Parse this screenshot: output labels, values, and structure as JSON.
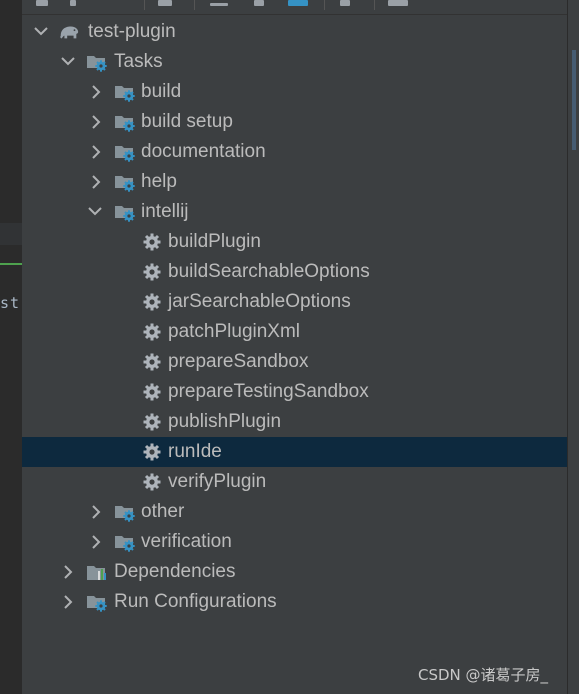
{
  "tree": {
    "root": {
      "label": "test-plugin",
      "icon": "gradle-elephant-icon"
    },
    "tasks": {
      "label": "Tasks"
    },
    "groups_top": [
      {
        "label": "build"
      },
      {
        "label": "build setup"
      },
      {
        "label": "documentation"
      },
      {
        "label": "help"
      }
    ],
    "intellij": {
      "label": "intellij",
      "tasks": [
        {
          "label": "buildPlugin"
        },
        {
          "label": "buildSearchableOptions"
        },
        {
          "label": "jarSearchableOptions"
        },
        {
          "label": "patchPluginXml"
        },
        {
          "label": "prepareSandbox"
        },
        {
          "label": "prepareTestingSandbox"
        },
        {
          "label": "publishPlugin"
        },
        {
          "label": "runIde",
          "selected": true
        },
        {
          "label": "verifyPlugin"
        }
      ]
    },
    "groups_bottom": [
      {
        "label": "other"
      },
      {
        "label": "verification"
      }
    ],
    "dependencies": {
      "label": "Dependencies"
    },
    "run_configurations": {
      "label": "Run Configurations"
    }
  },
  "editor_fragment": "st",
  "watermark": "CSDN @诸葛子房_",
  "colors": {
    "background": "#3c3f41",
    "selection": "#0d293e",
    "text": "#bbbbbb",
    "gear": "#aeb4bb",
    "folder": "#87939a",
    "accent_gear": "#3592c4"
  }
}
